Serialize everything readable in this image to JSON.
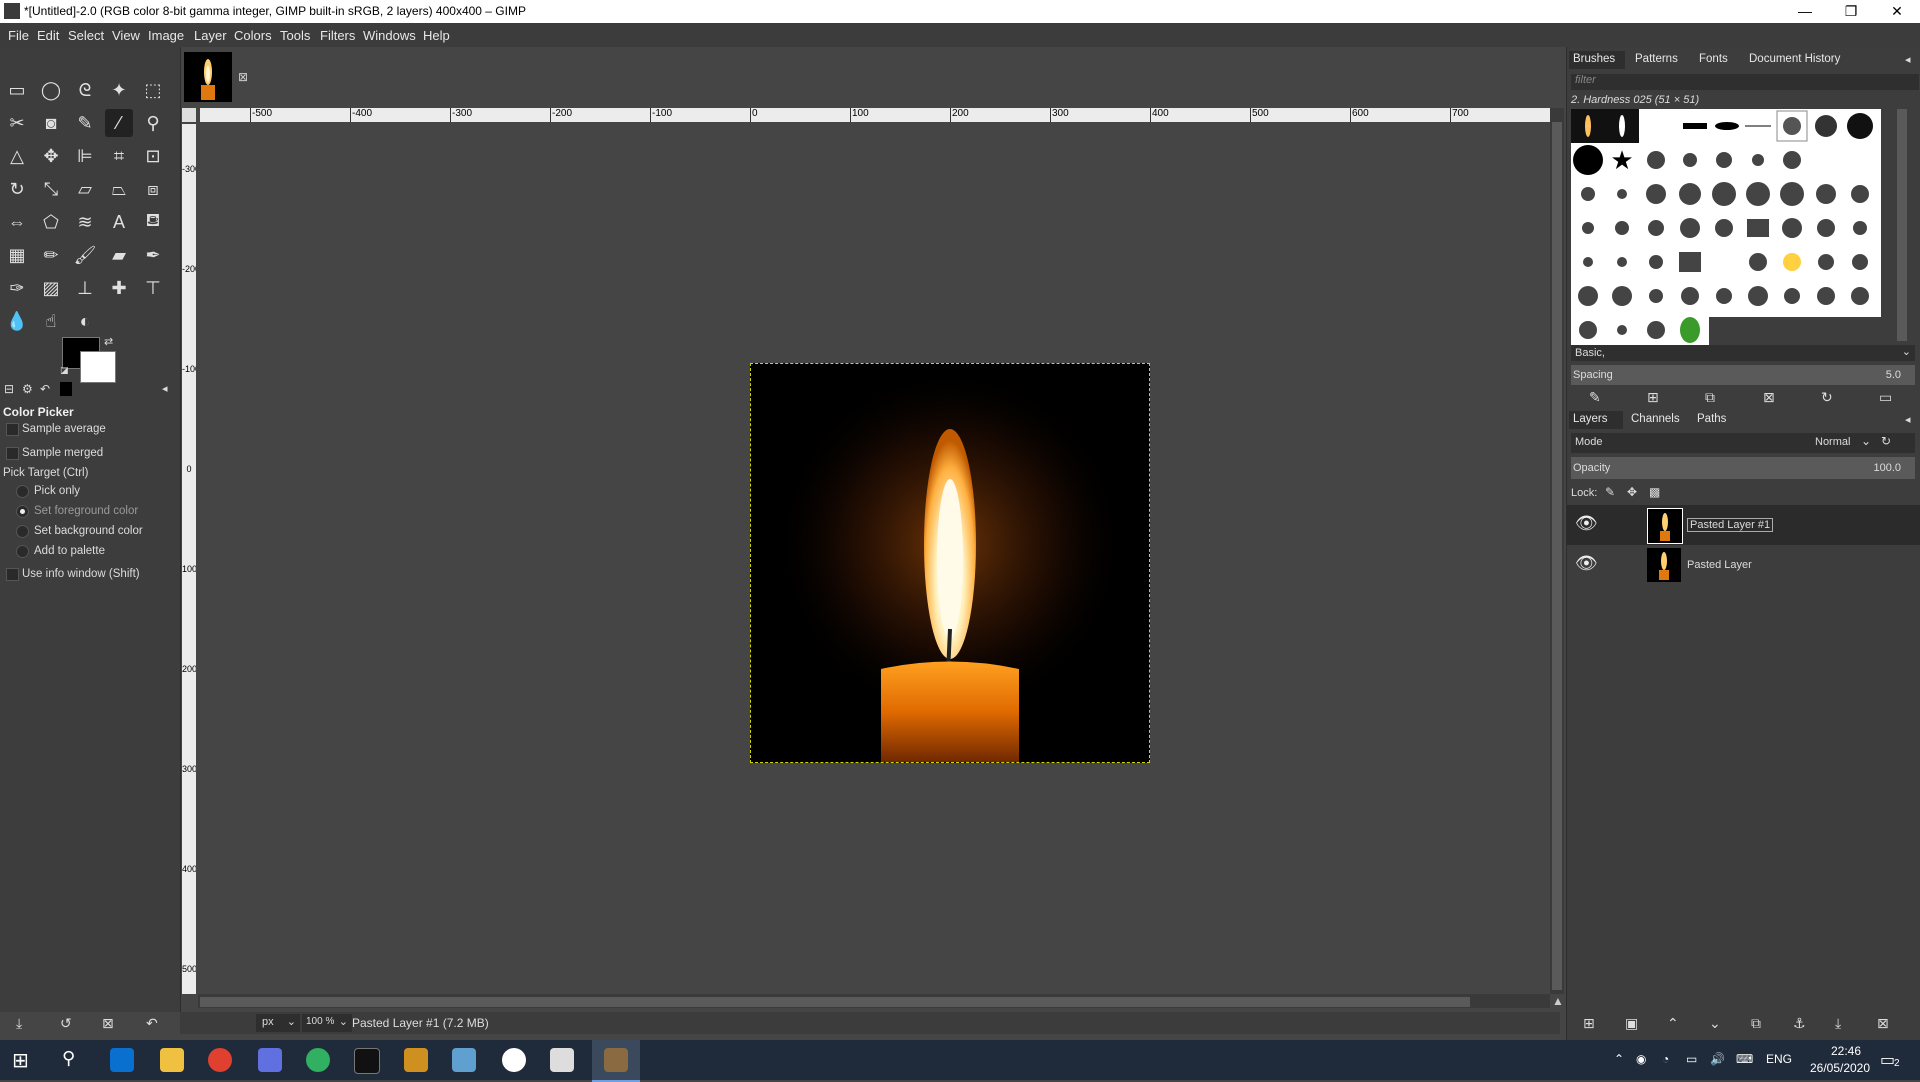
{
  "window": {
    "title": "*[Untitled]-2.0 (RGB color 8-bit gamma integer, GIMP built-in sRGB, 2 layers) 400x400 – GIMP",
    "minimize": "—",
    "maximize": "❐",
    "close": "✕"
  },
  "menu": [
    "File",
    "Edit",
    "Select",
    "View",
    "Image",
    "Layer",
    "Colors",
    "Tools",
    "Filters",
    "Windows",
    "Help"
  ],
  "tool_options": {
    "title": "Color Picker",
    "sample_average": "Sample average",
    "sample_merged": "Sample merged",
    "pick_target": "Pick Target  (Ctrl)",
    "radio": [
      "Pick only",
      "Set foreground color",
      "Set background color",
      "Add to palette"
    ],
    "selected_radio": "Set foreground color",
    "use_info": "Use info window  (Shift)"
  },
  "rulers": {
    "h": [
      "-500",
      "-400",
      "-300",
      "-200",
      "-100",
      "0",
      "100",
      "200",
      "300",
      "400",
      "500",
      "600",
      "700"
    ],
    "v": [
      "-300",
      "-200",
      "-100",
      "0",
      "100",
      "200",
      "300",
      "400",
      "500",
      "600"
    ]
  },
  "status": {
    "unit": "px",
    "zoom": "100 %",
    "message": "Pasted Layer #1 (7.2 MB)"
  },
  "brushes_panel": {
    "tabs": [
      "Brushes",
      "Patterns",
      "Fonts",
      "Document History"
    ],
    "filter_placeholder": "filter",
    "brush_name": "2. Hardness 025 (51 × 51)",
    "preset": "Basic,",
    "spacing_label": "Spacing",
    "spacing_value": "5.0"
  },
  "layers_panel": {
    "tabs": [
      "Layers",
      "Channels",
      "Paths"
    ],
    "mode_label": "Mode",
    "mode_value": "Normal",
    "opacity_label": "Opacity",
    "opacity_value": "100.0",
    "lock_label": "Lock:",
    "layers": [
      "Pasted Layer #1",
      "Pasted Layer"
    ]
  },
  "taskbar": {
    "lang": "ENG",
    "time": "22:46",
    "date": "26/05/2020",
    "notifications": "2"
  },
  "colors": {
    "fg": "#000000",
    "bg": "#ffffff",
    "selection_border": "#d4d400"
  }
}
